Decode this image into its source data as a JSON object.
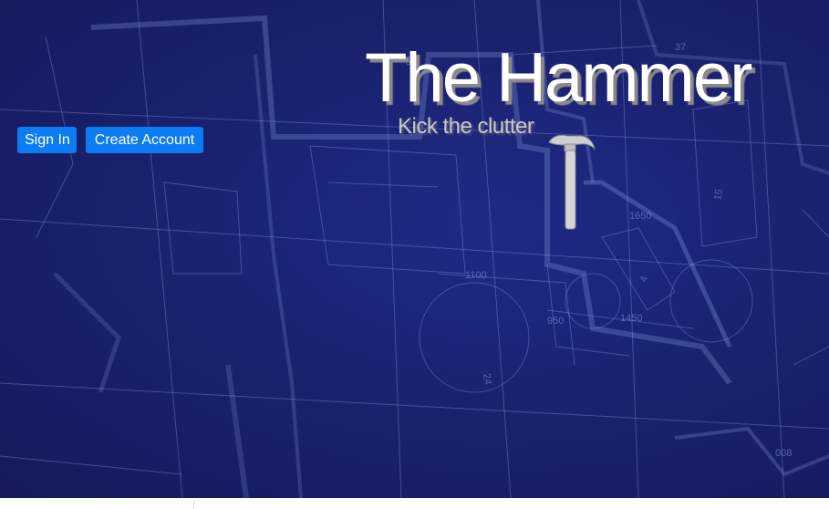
{
  "header": {
    "sign_in_label": "Sign In",
    "create_account_label": "Create Account"
  },
  "hero": {
    "title": "The Hammer",
    "tagline": "Kick the clutter",
    "logo_icon": "hammer-icon",
    "background": "blueprint floor plan"
  },
  "colors": {
    "button_bg": "#0b7cf2",
    "button_text": "#ffffff",
    "hero_bg": "#1a2270",
    "title_text": "#ffffff",
    "tagline_text": "#c9c9cc"
  }
}
